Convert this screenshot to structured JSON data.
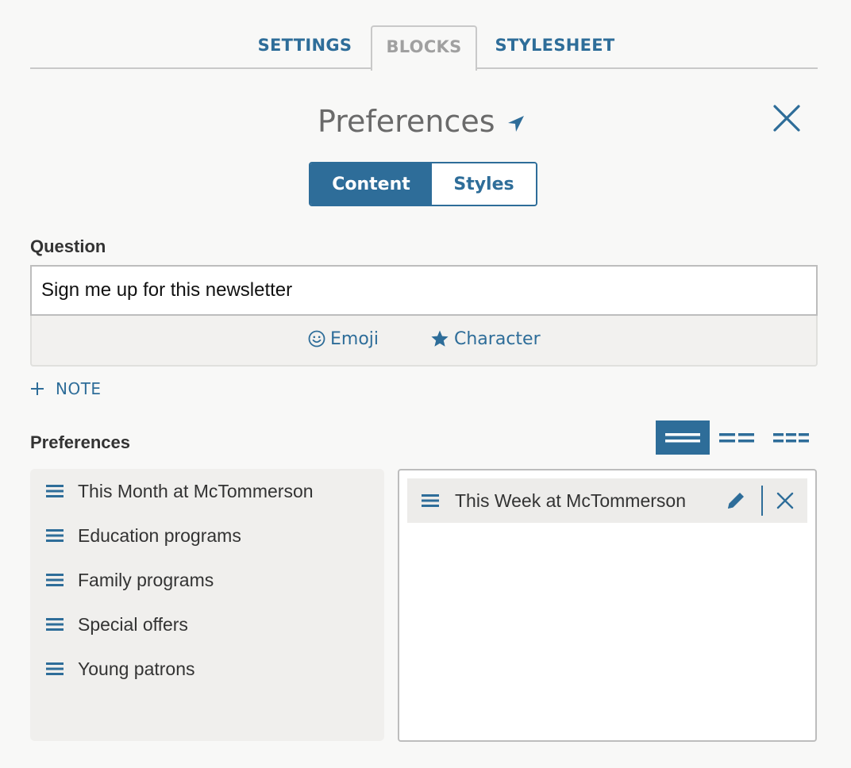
{
  "tabs": [
    {
      "label": "SETTINGS",
      "active": false
    },
    {
      "label": "BLOCKS",
      "active": true
    },
    {
      "label": "STYLESHEET",
      "active": false
    }
  ],
  "block": {
    "title": "Preferences"
  },
  "segments": {
    "content": "Content",
    "styles": "Styles",
    "selected": "content"
  },
  "question": {
    "label": "Question",
    "value": "Sign me up for this newsletter",
    "tools": {
      "emoji": "Emoji",
      "character": "Character"
    }
  },
  "note_label": "NOTE",
  "preferences": {
    "label": "Preferences",
    "available": [
      "This Month at McTommerson",
      "Education programs",
      "Family programs",
      "Special offers",
      "Young patrons"
    ],
    "selected": [
      "This Week at McTommerson"
    ],
    "layout": {
      "selected": "one-column",
      "options": [
        "one-column",
        "two-columns",
        "three-columns"
      ]
    }
  },
  "colors": {
    "accent": "#2e6d99",
    "muted": "#a0a0a0",
    "panel": "#f0efed"
  }
}
